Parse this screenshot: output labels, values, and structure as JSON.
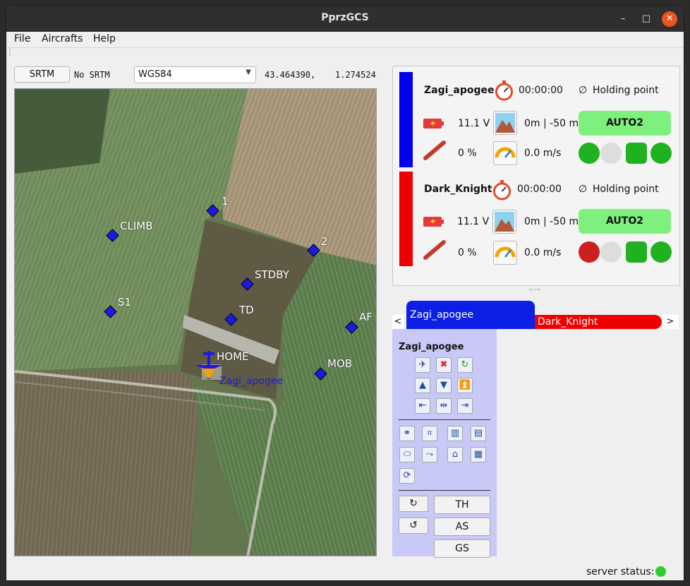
{
  "window": {
    "title": "PprzGCS"
  },
  "menu": {
    "file": "File",
    "aircrafts": "Aircrafts",
    "help": "Help"
  },
  "toolbar": {
    "srtm_button": "SRTM",
    "srtm_status": "No SRTM",
    "projection": "WGS84",
    "lat": "43.464390,",
    "lon": "1.274524"
  },
  "map": {
    "waypoints": [
      {
        "name": "1"
      },
      {
        "name": "CLIMB"
      },
      {
        "name": "2"
      },
      {
        "name": "STDBY"
      },
      {
        "name": "S1"
      },
      {
        "name": "TD"
      },
      {
        "name": "AF"
      },
      {
        "name": "HOME"
      },
      {
        "name": "MOB"
      }
    ],
    "aircraft_label": "Zagi_apogee"
  },
  "strips": [
    {
      "name": "Zagi_apogee",
      "color": "#0000ee",
      "time": "00:00:00",
      "block": "Holding point",
      "voltage": "11.1 V",
      "alt": "0m | -50 m",
      "mode": "AUTO2",
      "throttle": "0 %",
      "speed": "0.0 m/s"
    },
    {
      "name": "Dark_Knight",
      "color": "#ee0000",
      "time": "00:00:00",
      "block": "Holding point",
      "voltage": "11.1 V",
      "alt": "0m | -50 m",
      "mode": "AUTO2",
      "throttle": "0 %",
      "speed": "0.0 m/s"
    }
  ],
  "tabs": {
    "left_arrow": "<",
    "right_arrow": ">",
    "tab1": "Zagi_apogee",
    "tab2": "Dark_Knight"
  },
  "panel": {
    "title": "Zagi_apogee",
    "th": "TH",
    "as": "AS",
    "gs": "GS"
  },
  "statusbar": {
    "label": "server status:",
    "color": "#2ecc2e"
  }
}
